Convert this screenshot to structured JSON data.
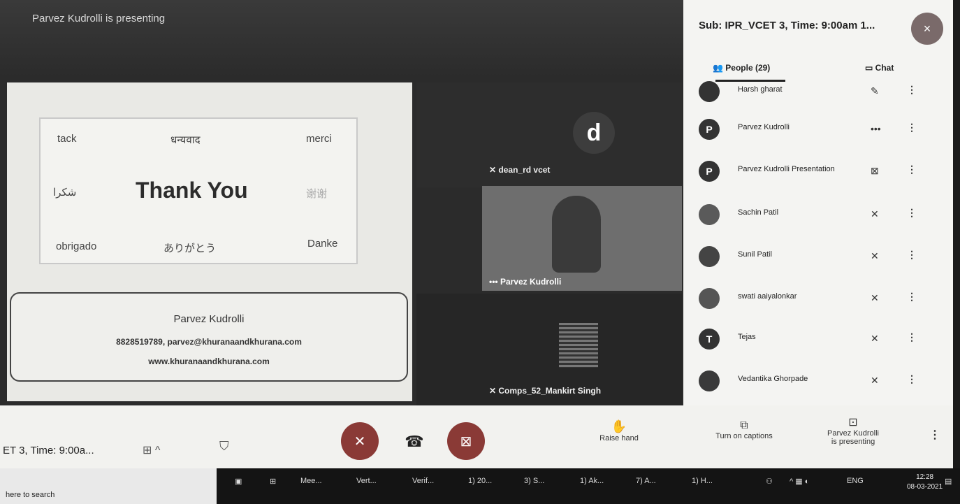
{
  "presenting_label": "Parvez Kudrolli is presenting",
  "slide": {
    "thank_words": {
      "top_left": "tack",
      "top_mid": "धन्यवाद",
      "top_right": "merci",
      "mid_left": "شكرا",
      "mid_right": "谢谢",
      "bottom_left": "obrigado",
      "bottom_mid": "ありがとう",
      "bottom_right": "Danke"
    },
    "main": "Thank You",
    "contact_name": "Parvez Kudrolli",
    "contact_phone": "8828519789, parvez@khuranaandkhurana.com",
    "contact_web": "www.khuranaandkhurana.com"
  },
  "tiles": {
    "dean_avatar": "d",
    "dean_name": "dean_rd vcet",
    "parvez_name": "Parvez Kudrolli",
    "comps_name": "Comps_52_Mankirt Singh"
  },
  "panel": {
    "title": "Sub: IPR_VCET 3, Time: 9:00am 1...",
    "close": "×",
    "people_tab": "People (29)",
    "chat_tab": "Chat",
    "participants": [
      {
        "initial": "",
        "name": "Harsh gharat"
      },
      {
        "initial": "P",
        "name": "Parvez Kudrolli"
      },
      {
        "initial": "P",
        "name": "Parvez Kudrolli Presentation"
      },
      {
        "initial": "",
        "name": "Sachin Patil"
      },
      {
        "initial": "",
        "name": "Sunil Patil"
      },
      {
        "initial": "",
        "name": "swati aaiyalonkar"
      },
      {
        "initial": "T",
        "name": "Tejas"
      },
      {
        "initial": "",
        "name": "Vedantika Ghorpade"
      }
    ]
  },
  "bottom": {
    "meeting_title": "ET 3, Time: 9:00a...",
    "raise_hand": "Raise hand",
    "captions": "Turn on captions",
    "presenting_line1": "Parvez Kudrolli",
    "presenting_line2": "is presenting"
  },
  "taskbar": {
    "search": "here to search",
    "apps": [
      "Mee...",
      "Vert...",
      "Verif...",
      "1) 20...",
      "3) S...",
      "1) Ak...",
      "7) A...",
      "1) H..."
    ],
    "lang": "ENG",
    "time": "12:28",
    "date": "08-03-2021"
  }
}
